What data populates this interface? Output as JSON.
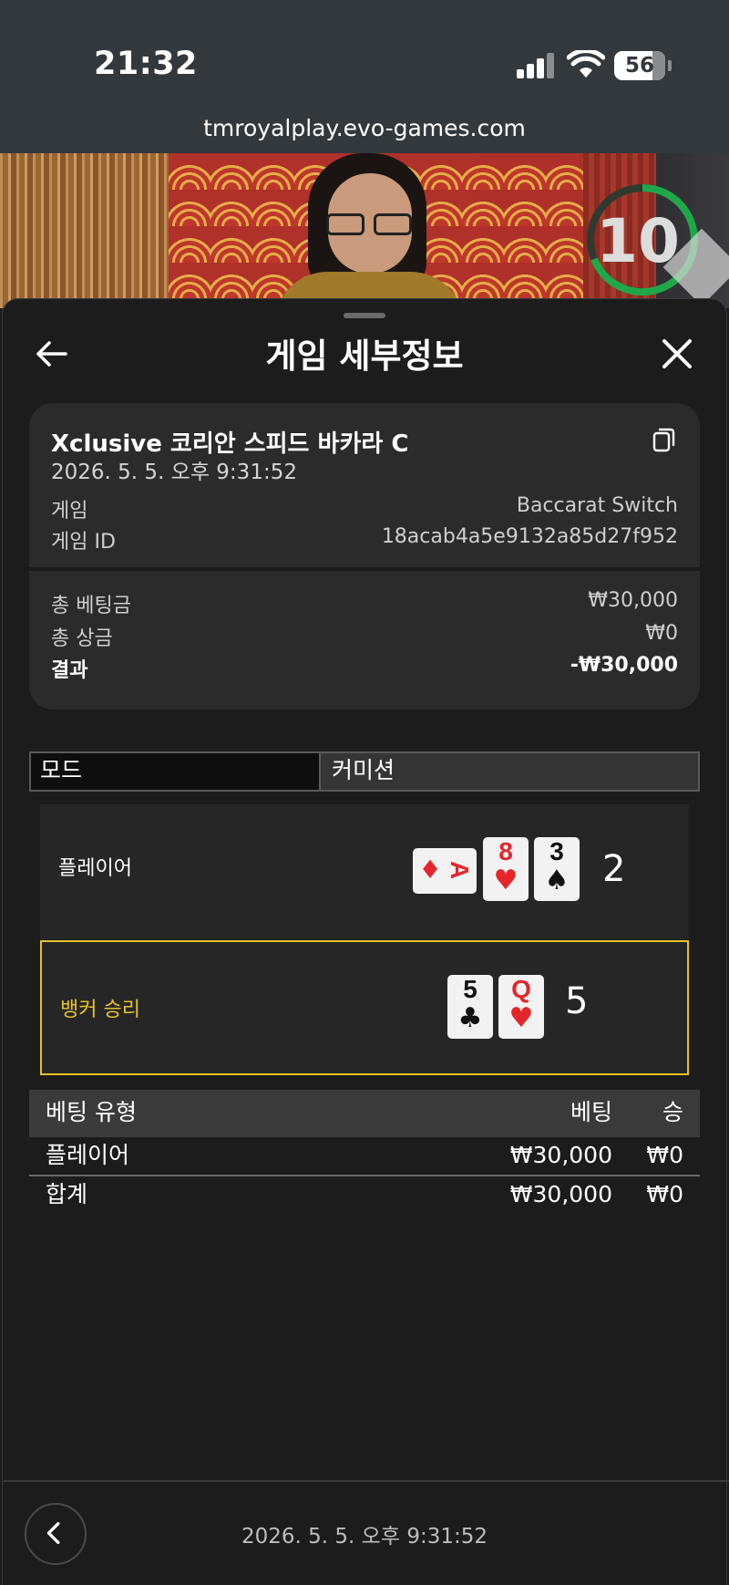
{
  "status_bar": {
    "time": "21:32",
    "battery": "56",
    "url": "tmroyalplay.evo-games.com"
  },
  "video": {
    "timer": "10",
    "timer_color": "#1fa84a"
  },
  "header": {
    "title": "게임 세부정보",
    "back_icon": "arrow-left-icon",
    "close_icon": "close-icon"
  },
  "summary": {
    "table_name": "Xclusive 코리안 스피드 바카라 C",
    "datetime": "2026. 5. 5. 오후 9:31:52",
    "game_label": "게임",
    "game_value": "Baccarat Switch",
    "game_id_label": "게임 ID",
    "game_id_value": "18acab4a5e9132a85d27f952",
    "total_bet_label": "총 베팅금",
    "total_bet_value": "₩30,000",
    "total_payout_label": "총 상금",
    "total_payout_value": "₩0",
    "result_label": "결과",
    "result_value": "-₩30,000"
  },
  "tabs": [
    {
      "label": "모드"
    },
    {
      "label": "커미션"
    }
  ],
  "hands": {
    "player": {
      "label": "플레이어",
      "score": "2",
      "cards": [
        {
          "rank": "A",
          "suit": "♦",
          "color": "red"
        },
        {
          "rank": "8",
          "suit": "♥",
          "color": "red"
        },
        {
          "rank": "3",
          "suit": "♠",
          "color": "black"
        }
      ]
    },
    "banker": {
      "label": "뱅커 승리",
      "score": "5",
      "highlight_color": "#e8c227",
      "cards": [
        {
          "rank": "5",
          "suit": "♣",
          "color": "black"
        },
        {
          "rank": "Q",
          "suit": "♥",
          "color": "red"
        }
      ]
    }
  },
  "bets_table": {
    "headers": {
      "type": "베팅 유형",
      "bet": "베팅",
      "win": "승"
    },
    "rows": [
      {
        "type": "플레이어",
        "bet": "₩30,000",
        "win": "₩0"
      }
    ],
    "total": {
      "type": "합계",
      "bet": "₩30,000",
      "win": "₩0"
    }
  },
  "footer": {
    "datetime": "2026. 5. 5. 오후 9:31:52",
    "back_icon": "chevron-left-icon"
  }
}
